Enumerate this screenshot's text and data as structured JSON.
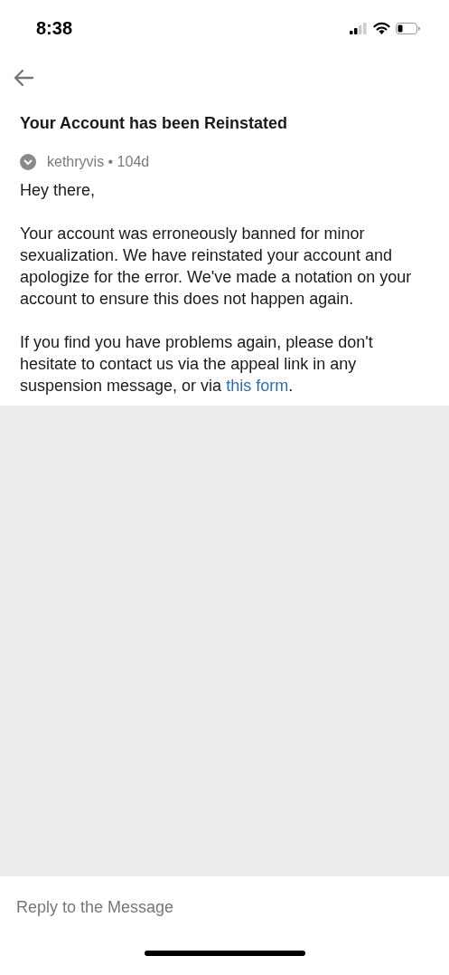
{
  "status_bar": {
    "time": "8:38"
  },
  "message": {
    "title": "Your Account has been Reinstated",
    "author": "kethryvis",
    "separator": "•",
    "age": "104d",
    "paragraphs": [
      {
        "text": "Hey there,"
      },
      {
        "text": "Your account was erroneously banned for minor sexualization. We have reinstated your account and apologize for the error. We've made a notation on your account to ensure this does not happen again."
      },
      {
        "text": "If you find you have problems again, please don't hesitate to contact us via the appeal link in any suspension message, or via ",
        "link": "this form",
        "after": "."
      }
    ]
  },
  "reply": {
    "placeholder": "Reply to the Message"
  }
}
